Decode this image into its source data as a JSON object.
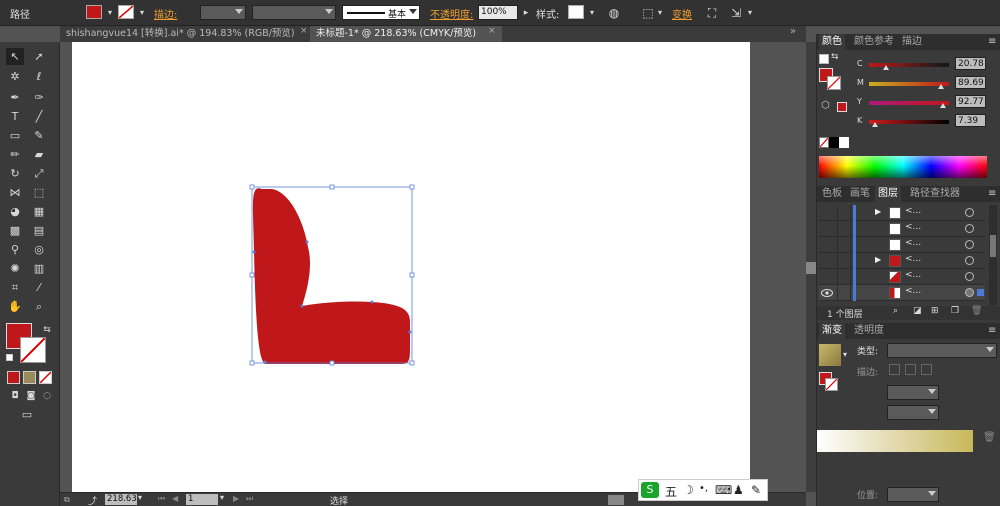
{
  "control_bar": {
    "path_label": "路径",
    "stroke_label": "描边:",
    "basic_label": "基本",
    "opacity_label": "不透明度:",
    "opacity_value": "100%",
    "style_label": "样式:",
    "transform_label": "变换",
    "fill_color": "#c0181a"
  },
  "doc_tabs": [
    {
      "label": "shishangvue14 [转换].ai* @ 194.83% (RGB/预览)",
      "close": "×"
    },
    {
      "label": "未标题-1* @ 218.63% (CMYK/预览)",
      "close": "×"
    }
  ],
  "status_bar": {
    "zoom": "218.63",
    "page": "1",
    "tool_name": "选择"
  },
  "color_panel": {
    "tabs": [
      "颜色",
      "颜色参考",
      "描边"
    ],
    "channels": [
      {
        "name": "C",
        "value": "20.78",
        "percent": 20.78
      },
      {
        "name": "M",
        "value": "89.69",
        "percent": 89.69
      },
      {
        "name": "Y",
        "value": "92.77",
        "percent": 92.77
      },
      {
        "name": "K",
        "value": "7.39",
        "percent": 7.39
      }
    ]
  },
  "layers_panel": {
    "tabs": [
      "色板",
      "画笔",
      "图层",
      "路径查找器"
    ],
    "rows": [
      {
        "name": "<...",
        "expand": "▶"
      },
      {
        "name": "<...",
        "expand": ""
      },
      {
        "name": "<...",
        "expand": ""
      },
      {
        "name": "<...",
        "expand": "▶"
      },
      {
        "name": "<...",
        "expand": ""
      },
      {
        "name": "<...",
        "expand": ""
      }
    ],
    "footer": "1 个图层"
  },
  "gradient_panel": {
    "tabs": [
      "渐变",
      "透明度"
    ],
    "type_label": "类型:",
    "stroke_label": "描边:",
    "position_label": "位置:"
  },
  "ime": {
    "items": [
      "五",
      "☽",
      "•,",
      "⌨",
      "♟",
      "✎"
    ]
  },
  "colors": {
    "shape_fill": "#c0181a",
    "selection": "#5b7fd6"
  }
}
